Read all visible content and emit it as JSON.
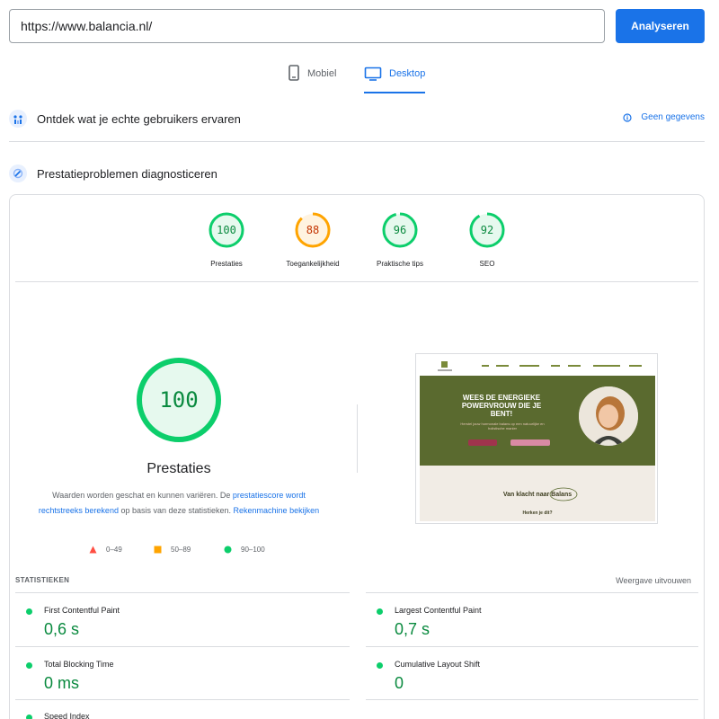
{
  "search": {
    "url": "https://www.balancia.nl/",
    "button_label": "Analyseren"
  },
  "device_tabs": [
    {
      "label": "Mobiel",
      "icon": "phone-icon",
      "active": false
    },
    {
      "label": "Desktop",
      "icon": "monitor-icon",
      "active": true
    }
  ],
  "field_data": {
    "title": "Ontdek wat je echte gebruikers ervaren",
    "no_data_label": "Geen gegevens"
  },
  "lab_data": {
    "title": "Prestatieproblemen diagnosticeren"
  },
  "scores": [
    {
      "label": "Prestaties",
      "value": 100,
      "color": "#0cce6b",
      "text_color": "#0a8a3f"
    },
    {
      "label": "Toegankelijkheid",
      "value": 88,
      "color": "#ffa400",
      "text_color": "#c33300"
    },
    {
      "label": "Praktische tips",
      "value": 96,
      "color": "#0cce6b",
      "text_color": "#0a8a3f"
    },
    {
      "label": "SEO",
      "value": 92,
      "color": "#0cce6b",
      "text_color": "#0a8a3f"
    }
  ],
  "performance": {
    "score": "100",
    "label": "Prestaties",
    "desc_pre": "Waarden worden geschat en kunnen variëren. De ",
    "desc_link1": "prestatiescore wordt rechtstreeks berekend",
    "desc_mid": " op basis van deze statistieken. ",
    "desc_link2": "Rekenmachine bekijken"
  },
  "legend": [
    {
      "range": "0–49",
      "color": "#ff4e42",
      "shape": "triangle"
    },
    {
      "range": "50–89",
      "color": "#ffa400",
      "shape": "square"
    },
    {
      "range": "90–100",
      "color": "#0cce6b",
      "shape": "circle"
    }
  ],
  "screenshot": {
    "headline": "WEES DE ENERGIEKE POWERVROUW DIE JE BENT!",
    "subtext": "Herstel jouw hormonale balans op een natuurlijke en holistische manier",
    "tagline": "Van klacht naar Balans",
    "question": "Herken je dit?",
    "hero_color": "#5a6a2f"
  },
  "stats": {
    "heading": "STATISTIEKEN",
    "expand_label": "Weergave uitvouwen",
    "metrics": [
      {
        "name": "First Contentful Paint",
        "value": "0,6 s"
      },
      {
        "name": "Largest Contentful Paint",
        "value": "0,7 s"
      },
      {
        "name": "Total Blocking Time",
        "value": "0 ms"
      },
      {
        "name": "Cumulative Layout Shift",
        "value": "0"
      },
      {
        "name": "Speed Index",
        "value": ""
      }
    ]
  }
}
